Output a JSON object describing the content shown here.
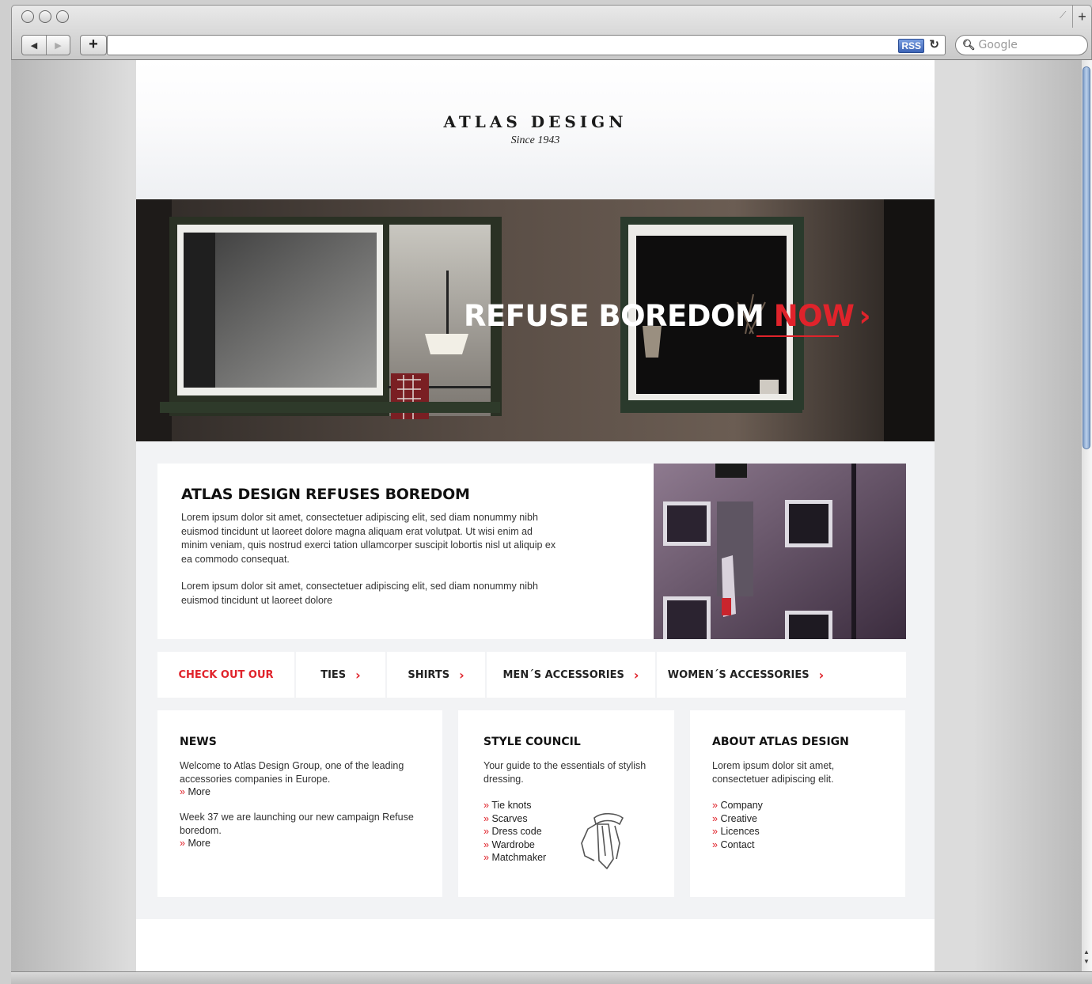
{
  "browser": {
    "search_placeholder": "Google",
    "rss_label": "RSS",
    "new_tab": "+"
  },
  "header": {
    "logo": "ATLAS DESIGN",
    "tagline": "Since 1943"
  },
  "hero": {
    "title_part1": "REFUSE BOREDOM ",
    "title_part2": "NOW",
    "chevron": "›",
    "accent_color": "#e0232b"
  },
  "feature": {
    "title": "ATLAS DESIGN REFUSES BOREDOM",
    "paragraphs": [
      "Lorem ipsum dolor sit amet, consectetuer adipiscing elit, sed diam nonummy nibh euismod tincidunt ut laoreet dolore magna aliquam erat volutpat. Ut wisi enim ad minim veniam, quis nostrud exerci tation ullamcorper suscipit lobortis nisl ut aliquip ex ea commodo consequat.",
      "Lorem ipsum dolor sit amet, consectetuer adipiscing elit, sed diam nonummy nibh euismod tincidunt ut laoreet dolore"
    ]
  },
  "categories": {
    "lead": "CHECK OUT OUR",
    "items": [
      "TIES",
      "SHIRTS",
      "MEN´S ACCESSORIES",
      "WOMEN´S ACCESSORIES"
    ],
    "chevron": "›"
  },
  "news": {
    "title": "NEWS",
    "items": [
      {
        "text": "Welcome to Atlas Design Group, one of the leading accessories companies in Europe.",
        "more": "More"
      },
      {
        "text": "Week 37 we are launching our new campaign Refuse boredom.",
        "more": "More"
      }
    ]
  },
  "style_council": {
    "title": "STYLE COUNCIL",
    "intro": "Your guide to the essentials of stylish dressing.",
    "links": [
      "Tie knots",
      "Scarves",
      "Dress code",
      "Wardrobe",
      "Matchmaker"
    ],
    "icon": "tie-icon"
  },
  "about": {
    "title": "ABOUT ATLAS DESIGN",
    "intro": "Lorem ipsum dolor sit amet, consectetuer adipiscing elit.",
    "links": [
      "Company",
      "Creative",
      "Licences",
      "Contact"
    ]
  },
  "bullet": "»"
}
